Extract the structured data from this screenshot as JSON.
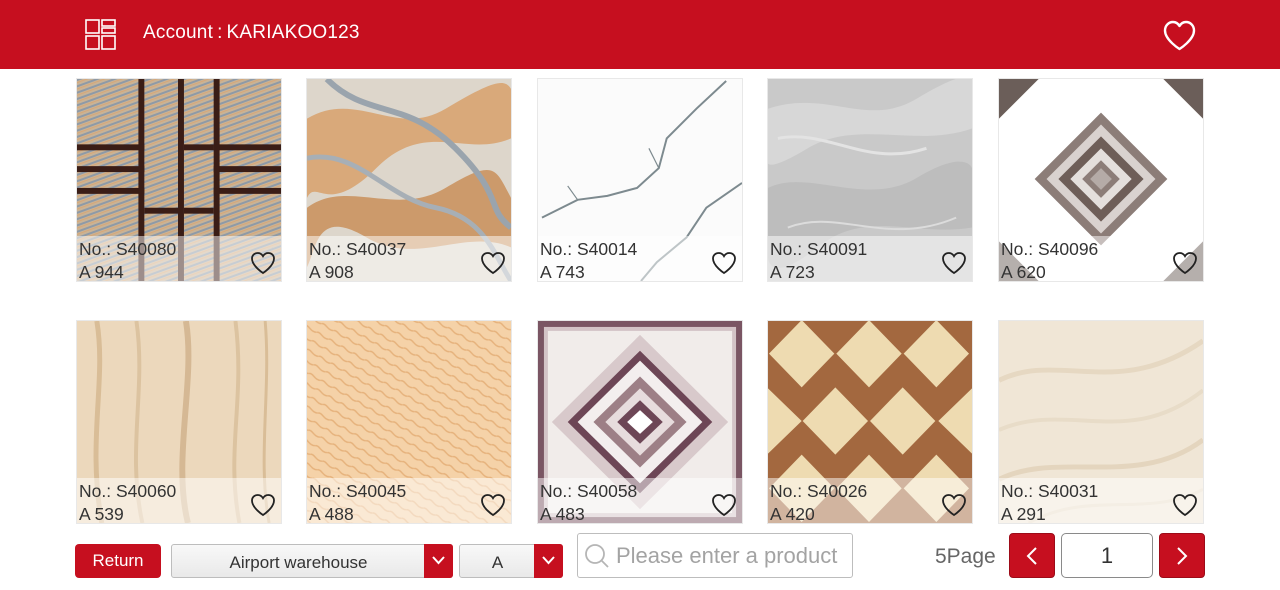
{
  "header": {
    "account_label": "Account",
    "separator": ":",
    "account_id": "KARIAKOO123",
    "menu_icon": "grid-icon",
    "favorites_icon": "heart-outline-icon"
  },
  "tiles": [
    {
      "code": "No.: S40080",
      "qty": "A 944",
      "pattern": "wood-lines"
    },
    {
      "code": "No.: S40037",
      "qty": "A 908",
      "pattern": "marble-swirl"
    },
    {
      "code": "No.: S40014",
      "qty": "A 743",
      "pattern": "white-vein"
    },
    {
      "code": "No.: S40091",
      "qty": "A 723",
      "pattern": "grey-marble"
    },
    {
      "code": "No.: S40096",
      "qty": "A 620",
      "pattern": "diamond-grey"
    },
    {
      "code": "No.: S40060",
      "qty": "A 539",
      "pattern": "light-wood"
    },
    {
      "code": "No.: S40045",
      "qty": "A 488",
      "pattern": "peach-texture"
    },
    {
      "code": "No.: S40058",
      "qty": "A 483",
      "pattern": "diamond-purple"
    },
    {
      "code": "No.: S40026",
      "qty": "A 420",
      "pattern": "checker-brown"
    },
    {
      "code": "No.: S40031",
      "qty": "A 291",
      "pattern": "beige-stone"
    }
  ],
  "footer": {
    "return_label": "Return",
    "warehouse_value": "Airport  warehouse",
    "grade_value": "A",
    "search_placeholder": "Please enter a product",
    "page_count_label": "5Page",
    "current_page": "1"
  },
  "colors": {
    "brand_red": "#c60f1f"
  }
}
